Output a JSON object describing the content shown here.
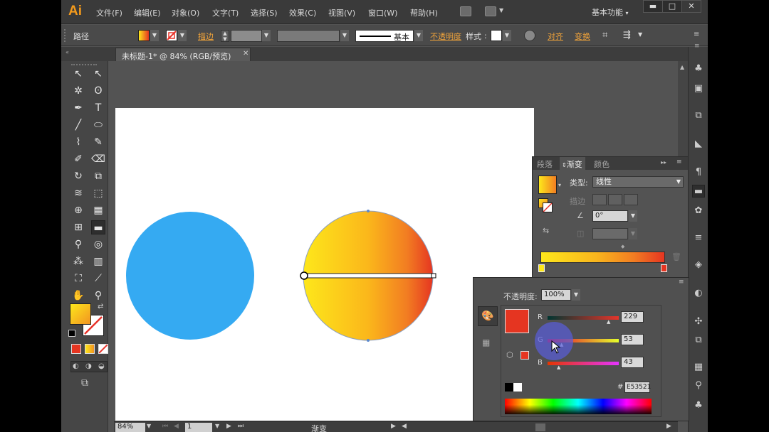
{
  "app": {
    "logo": "Ai"
  },
  "menu": {
    "items": [
      "文件(F)",
      "编辑(E)",
      "对象(O)",
      "文字(T)",
      "选择(S)",
      "效果(C)",
      "视图(V)",
      "窗口(W)",
      "帮助(H)"
    ],
    "workspace": "基本功能"
  },
  "window_controls": {
    "minimize": "▬",
    "maximize": "□",
    "close": "✕"
  },
  "control_bar": {
    "object_type": "路径",
    "stroke_label": "描边",
    "stroke_style_label": "基本",
    "opacity_label": "不透明度",
    "style_label": "样式",
    "align_label": "对齐",
    "transform_label": "变换"
  },
  "document": {
    "tab_title": "未标题-1* @ 84% (RGB/预览)",
    "close": "✕"
  },
  "status_bar": {
    "zoom": "84%",
    "artboard_index": "1",
    "current_tool": "渐变"
  },
  "gradient_panel": {
    "tabs": [
      "段落",
      "渐变",
      "颜色"
    ],
    "active_tab": "渐变",
    "type_label": "类型:",
    "type_value": "线性",
    "stroke_label": "描边",
    "angle_value": "0°"
  },
  "color_panel": {
    "opacity_label": "不透明度:",
    "opacity_value": "100%",
    "r_label": "R",
    "g_label": "G",
    "b_label": "B",
    "r_value": "229",
    "g_value": "53",
    "b_value": "43",
    "hex_symbol": "#",
    "hex_value": "E53521"
  },
  "colors": {
    "circle_blue": "#35aaf2",
    "gradient_start": "#fde71b",
    "gradient_end": "#e53521",
    "accent_link": "#f0a33a"
  }
}
